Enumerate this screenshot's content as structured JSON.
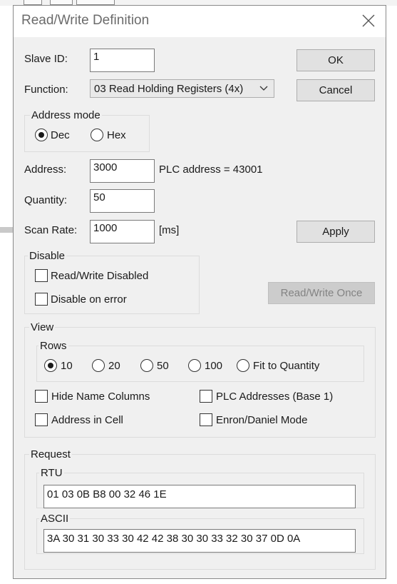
{
  "dialog": {
    "title": "Read/Write Definition"
  },
  "fields": {
    "slave_id_label": "Slave ID:",
    "slave_id_value": "1",
    "function_label": "Function:",
    "function_value": "03 Read Holding Registers (4x)",
    "address_label": "Address:",
    "address_value": "3000",
    "plc_address_text": "PLC address = 43001",
    "quantity_label": "Quantity:",
    "quantity_value": "50",
    "scan_rate_label": "Scan Rate:",
    "scan_rate_value": "1000",
    "scan_rate_unit": "[ms]"
  },
  "buttons": {
    "ok": "OK",
    "cancel": "Cancel",
    "apply": "Apply",
    "read_write_once": "Read/Write Once"
  },
  "address_mode": {
    "label": "Address mode",
    "options": [
      "Dec",
      "Hex"
    ],
    "selected": "Dec"
  },
  "disable": {
    "label": "Disable",
    "read_write_disabled": "Read/Write Disabled",
    "disable_on_error": "Disable on error"
  },
  "view": {
    "label": "View",
    "rows_label": "Rows",
    "rows_options": [
      "10",
      "20",
      "50",
      "100",
      "Fit to Quantity"
    ],
    "rows_selected": "10",
    "hide_name_columns": "Hide Name Columns",
    "plc_addresses": "PLC Addresses (Base 1)",
    "address_in_cell": "Address in Cell",
    "enron_daniel": "Enron/Daniel Mode"
  },
  "request": {
    "label": "Request",
    "rtu_label": "RTU",
    "rtu_value": "01 03 0B B8 00 32 46 1E",
    "ascii_label": "ASCII",
    "ascii_value": "3A 30 31 30 33 30 42 42 38 30 30 33 32 30 37 0D 0A"
  }
}
